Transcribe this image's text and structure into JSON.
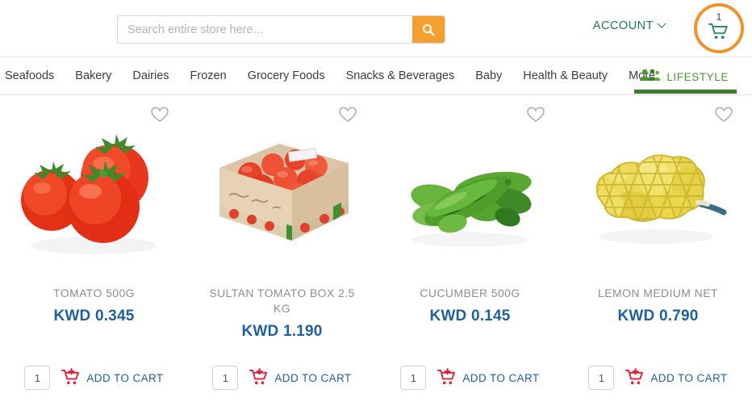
{
  "header": {
    "search": {
      "placeholder": "Search entire store here...",
      "value": "",
      "icon": "search-icon"
    },
    "account": {
      "label": "ACCOUNT",
      "icon": "chevron-down-icon",
      "color": "#1f7a52"
    },
    "cart": {
      "count": "1",
      "icon": "shopping-cart-icon",
      "ring_color": "#f0932b",
      "icon_color": "#2e8b63"
    }
  },
  "nav": {
    "items": [
      {
        "label": "Seafoods"
      },
      {
        "label": "Bakery"
      },
      {
        "label": "Dairies"
      },
      {
        "label": "Frozen"
      },
      {
        "label": "Grocery Foods"
      },
      {
        "label": "Snacks & Beverages"
      },
      {
        "label": "Baby"
      },
      {
        "label": "Health & Beauty"
      },
      {
        "label": "More"
      }
    ],
    "lifestyle": {
      "label": "LIFESTYLE",
      "icon": "people-group-icon",
      "active": true,
      "accent": "#3b7d28",
      "text_color": "#4a9a2f"
    }
  },
  "products": [
    {
      "name": "TOMATO 500G",
      "price": "KWD 0.345",
      "image": "tomatoes-image",
      "wishlist_icon": "heart-outline-icon",
      "quantity": "1",
      "add_to_cart_label": "ADD TO CART",
      "add_to_cart_icon": "add-to-cart-icon"
    },
    {
      "name": "SULTAN TOMATO BOX 2.5 KG",
      "price": "KWD 1.190",
      "image": "tomato-box-image",
      "wishlist_icon": "heart-outline-icon",
      "quantity": "1",
      "add_to_cart_label": "ADD TO CART",
      "add_to_cart_icon": "add-to-cart-icon"
    },
    {
      "name": "CUCUMBER 500G",
      "price": "KWD 0.145",
      "image": "cucumbers-image",
      "wishlist_icon": "heart-outline-icon",
      "quantity": "1",
      "add_to_cart_label": "ADD TO CART",
      "add_to_cart_icon": "add-to-cart-icon"
    },
    {
      "name": "LEMON MEDIUM NET",
      "price": "KWD 0.790",
      "image": "lemon-net-bag-image",
      "wishlist_icon": "heart-outline-icon",
      "quantity": "1",
      "add_to_cart_label": "ADD TO CART",
      "add_to_cart_icon": "add-to-cart-icon"
    }
  ],
  "colors": {
    "price": "#1f5f9e",
    "search_button": "#f5a02e",
    "cart_icon_red": "#e0213a"
  }
}
